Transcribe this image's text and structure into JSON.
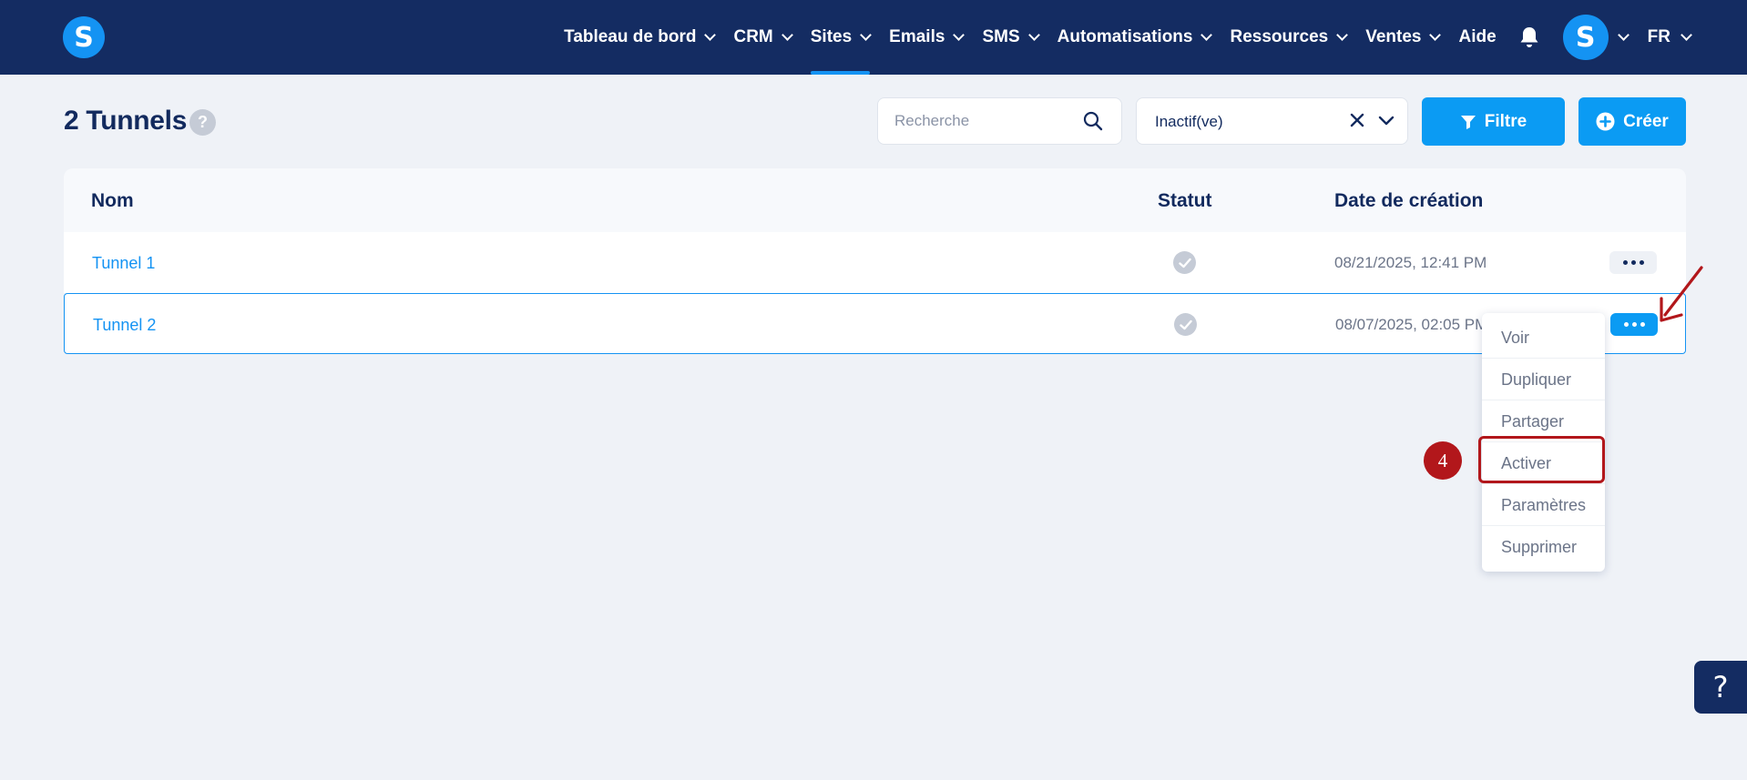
{
  "app": {
    "logo_letter": "S"
  },
  "nav": {
    "items": [
      {
        "label": "Tableau de bord",
        "has_dropdown": true
      },
      {
        "label": "CRM",
        "has_dropdown": true
      },
      {
        "label": "Sites",
        "has_dropdown": true,
        "active": true
      },
      {
        "label": "Emails",
        "has_dropdown": true
      },
      {
        "label": "SMS",
        "has_dropdown": true
      },
      {
        "label": "Automatisations",
        "has_dropdown": true
      },
      {
        "label": "Ressources",
        "has_dropdown": true
      },
      {
        "label": "Ventes",
        "has_dropdown": true
      },
      {
        "label": "Aide",
        "has_dropdown": false
      }
    ],
    "avatar_letter": "S",
    "language": "FR"
  },
  "header": {
    "title": "2 Tunnels",
    "help": "?",
    "search_placeholder": "Recherche",
    "status_filter_value": "Inactif(ve)",
    "filter_button": "Filtre",
    "create_button": "Créer"
  },
  "table": {
    "columns": {
      "name": "Nom",
      "status": "Statut",
      "created": "Date de création"
    },
    "rows": [
      {
        "name": "Tunnel 1",
        "date": "08/21/2025, 12:41 PM"
      },
      {
        "name": "Tunnel 2",
        "date": "08/07/2025, 02:05 PM"
      }
    ]
  },
  "row_menu": {
    "items": [
      "Voir",
      "Dupliquer",
      "Partager",
      "Activer",
      "Paramètres",
      "Supprimer"
    ]
  },
  "annotation": {
    "step": "4"
  },
  "help_fab": "?",
  "colors": {
    "nav_bg": "#142c62",
    "accent": "#1493f3",
    "highlight": "#b2171b"
  }
}
